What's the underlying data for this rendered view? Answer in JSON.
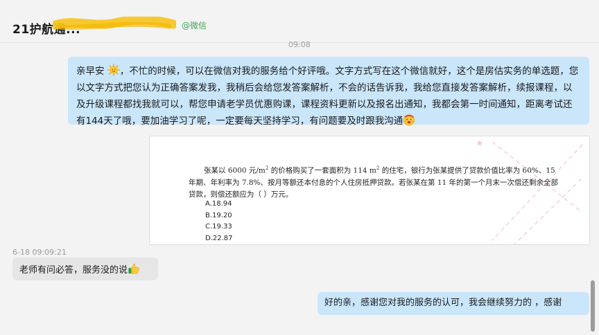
{
  "header": {
    "chat_title": "21护航通...",
    "source_tag": "@微信"
  },
  "timestamps": {
    "top": "09:08",
    "mid": "6-18 09:09:21"
  },
  "messages": {
    "m1_text_a": "亲早安",
    "m1_text_b": "，不忙的时候，可以在微信对我的服务给个好评哦。文字方式写在这个微信就好，这个是房估实务的单选题，您以文字方式把您认为正确答案发我，我稍后会给您发答案解析，不会的话告诉我，我给您直接发答案解析，续报课程，以及升级课程都找我就可以，帮您申请老学员优惠购课，课程资料更新以及报名出通知，我都会第一时间通知，距离考试还有144天了哦，要加油学习了呢，一定要每天坚持学习，有问题要及时跟我沟通",
    "m2_image": {
      "question_a": "张某以 6000 元/m",
      "question_sup": "2",
      "question_b": " 的价格购买了一套面积为 114 m",
      "question_sup2": "2",
      "question_c": " 的住宅，银行为张某提供了贷款价值比率为 60%、15 年期、年利率为 7.8%、按月等额还本付息的个人住房抵押贷款。若张某在第 11 年的第一个月末一次偿还剩余全部贷款，则偿还额应为（      ）万元。",
      "options": [
        "A.18.94",
        "B.19.20",
        "C.19.33",
        "D.22.87"
      ]
    },
    "m3_text": "老师有问必答，服务没的说",
    "m4_text": "好的亲，感谢您对我的服务的认可，我会继续努力的 ，感谢"
  },
  "icons": {
    "sun_emoji": "sun-face-emoji",
    "hot_emoji": "hot-face-emoji",
    "thumbs_emoji": "thumbs-up-emoji"
  },
  "colors": {
    "bubble_right": "#c9e6fb",
    "bubble_left": "#e6e6e6",
    "wechat_green": "#3fa55b",
    "redact_yellow": "#f7c520"
  }
}
